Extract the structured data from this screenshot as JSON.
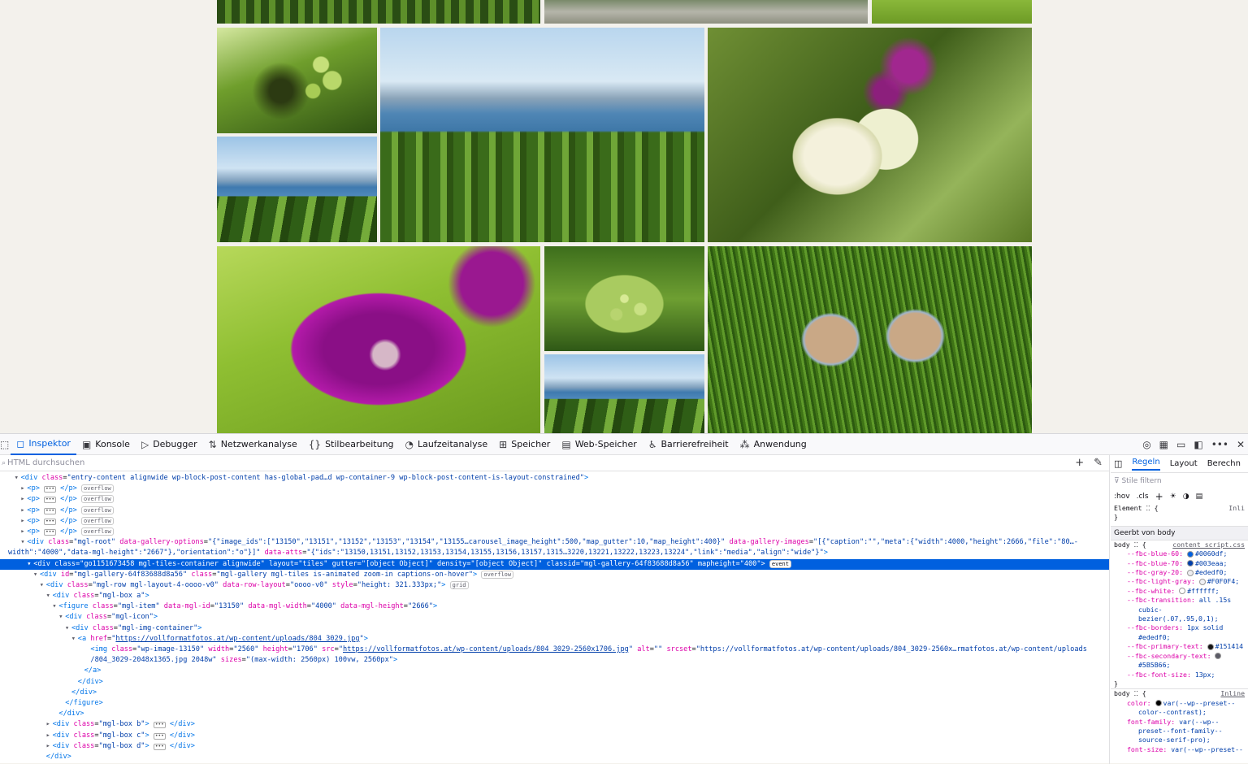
{
  "devtools": {
    "tabs": [
      {
        "label": "Inspektor",
        "icon": "inspector-icon"
      },
      {
        "label": "Konsole",
        "icon": "console-icon"
      },
      {
        "label": "Debugger",
        "icon": "debugger-icon"
      },
      {
        "label": "Netzwerkanalyse",
        "icon": "network-icon"
      },
      {
        "label": "Stilbearbeitung",
        "icon": "style-editor-icon"
      },
      {
        "label": "Laufzeitanalyse",
        "icon": "performance-icon"
      },
      {
        "label": "Speicher",
        "icon": "memory-icon"
      },
      {
        "label": "Web-Speicher",
        "icon": "storage-icon"
      },
      {
        "label": "Barrierefreiheit",
        "icon": "accessibility-icon"
      },
      {
        "label": "Anwendung",
        "icon": "application-icon"
      }
    ],
    "search_placeholder": "HTML durchsuchen",
    "rules_tabs": [
      "Regeln",
      "Layout",
      "Berechn"
    ],
    "filter_placeholder": "Stile filtern",
    "pseudo_buttons": [
      ":hov",
      ".cls"
    ],
    "element_selector": "Element",
    "element_source": "Inli",
    "inherited_header": "Geerbt von body",
    "body_rule1": {
      "selector": "body",
      "source": "content_script.css",
      "props": [
        {
          "name": "--fbc-blue-60:",
          "value": "#0060df;",
          "color": "#0060df"
        },
        {
          "name": "--fbc-blue-70:",
          "value": "#003eaa;",
          "color": "#003eaa"
        },
        {
          "name": "--fbc-gray-20:",
          "value": "#ededf0;",
          "color": "#ededf0"
        },
        {
          "name": "--fbc-light-gray:",
          "value": "#F0F0F4;",
          "color": "#F0F0F4"
        },
        {
          "name": "--fbc-white:",
          "value": "#ffffff;",
          "color": "#ffffff"
        },
        {
          "name": "--fbc-transition:",
          "value": "all .15s",
          "color": ""
        },
        {
          "name": "",
          "value": "cubic-",
          "color": ""
        },
        {
          "name": "",
          "value": "bezier(.07,.95,0,1);",
          "color": ""
        },
        {
          "name": "--fbc-borders:",
          "value": "1px solid",
          "color": ""
        },
        {
          "name": "",
          "value": "#ededf0;",
          "color": ""
        },
        {
          "name": "--fbc-primary-text:",
          "value": "#151414",
          "color": "#151414"
        },
        {
          "name": "--fbc-secondary-text:",
          "value": "",
          "color": "#5B5B66"
        },
        {
          "name": "",
          "value": "#5B5B66;",
          "color": ""
        },
        {
          "name": "--fbc-font-size:",
          "value": "13px;",
          "color": ""
        }
      ]
    },
    "body_rule2": {
      "selector": "body",
      "source": "Inline",
      "props": [
        {
          "name": "color:",
          "value": "var(--wp--preset--",
          "color": "#000000"
        },
        {
          "name": "",
          "value": "color--contrast);",
          "color": ""
        },
        {
          "name": "font-family:",
          "value": "var(--wp--",
          "color": ""
        },
        {
          "name": "",
          "value": "preset--font-family--",
          "color": ""
        },
        {
          "name": "",
          "value": "source-serif-pro);",
          "color": ""
        },
        {
          "name": "font-size:",
          "value": "var(--wp--preset--",
          "color": ""
        }
      ]
    }
  },
  "html_tree": [
    {
      "indent": 4,
      "tw": "open",
      "html": "<span class=\"tag\">&lt;div</span> <span class=\"an\">class</span>=<span class=\"av\">\"entry-content alignwide wp-block-post-content has-global-pad…d wp-container-9 wp-block-post-content-is-layout-constrained\"</span><span class=\"tag\">&gt;</span>"
    },
    {
      "indent": 6,
      "tw": "closed",
      "html": "<span class=\"tag\">&lt;p&gt;</span> <span class=\"dots\">•••</span> <span class=\"tag\">&lt;/p&gt;</span> <span class=\"badge\">overflow</span>"
    },
    {
      "indent": 6,
      "tw": "closed",
      "html": "<span class=\"tag\">&lt;p&gt;</span> <span class=\"dots\">•••</span> <span class=\"tag\">&lt;/p&gt;</span> <span class=\"badge\">overflow</span>"
    },
    {
      "indent": 6,
      "tw": "closed",
      "html": "<span class=\"tag\">&lt;p&gt;</span> <span class=\"dots\">•••</span> <span class=\"tag\">&lt;/p&gt;</span> <span class=\"badge\">overflow</span>"
    },
    {
      "indent": 6,
      "tw": "closed",
      "html": "<span class=\"tag\">&lt;p&gt;</span> <span class=\"dots\">•••</span> <span class=\"tag\">&lt;/p&gt;</span> <span class=\"badge\">overflow</span>"
    },
    {
      "indent": 6,
      "tw": "closed",
      "html": "<span class=\"tag\">&lt;p&gt;</span> <span class=\"dots\">•••</span> <span class=\"tag\">&lt;/p&gt;</span> <span class=\"badge\">overflow</span>"
    },
    {
      "indent": 6,
      "tw": "open",
      "html": "<span class=\"tag\">&lt;div</span> <span class=\"an\">class</span>=<span class=\"av\">\"mgl-root\"</span> <span class=\"an\">data-gallery-options</span>=<span class=\"av\">\"{\"image_ids\":[\"13150\",\"13151\",\"13152\",\"13153\",\"13154\",\"13155…carousel_image_height\":500,\"map_gutter\":10,\"map_height\":400}\"</span> <span class=\"an\">data-gallery-images</span>=<span class=\"av\">\"[{\"caption\":\"\",\"meta\":{\"width\":4000,\"height\":2666,\"file\":\"80…-</span>"
    },
    {
      "indent": 0,
      "tw": "none",
      "html": "<span class=\"av\">width\":\"4000\",\"data-mgl-height\":\"2667\"},\"orientation\":\"o\"}]\"</span> <span class=\"an\">data-atts</span>=<span class=\"av\">\"{\"ids\":\"13150,13151,13152,13153,13154,13155,13156,13157,1315…3220,13221,13222,13223,13224\",\"link\":\"media\",\"align\":\"wide\"}\"</span><span class=\"tag\">&gt;</span>"
    },
    {
      "indent": 8,
      "tw": "open",
      "sel": true,
      "html": "<span class=\"tag\">&lt;div</span> <span class=\"an\">class</span>=<span class=\"av\">\"go1151673458 mgl-tiles-container alignwide\"</span> <span class=\"an\">layout</span>=<span class=\"av\">\"tiles\"</span> <span class=\"an\">gutter</span>=<span class=\"av\">\"[object Object]\"</span> <span class=\"an\">density</span>=<span class=\"av\">\"[object Object]\"</span> <span class=\"an\">classid</span>=<span class=\"av\">\"mgl-gallery-64f83688d8a56\"</span> <span class=\"an\">mapheight</span>=<span class=\"av\">\"400\"</span><span class=\"tag\">&gt;</span> <span class=\"badge\">event</span>"
    },
    {
      "indent": 10,
      "tw": "open",
      "html": "<span class=\"tag\">&lt;div</span> <span class=\"an\">id</span>=<span class=\"av\">\"mgl-gallery-64f83688d8a56\"</span> <span class=\"an\">class</span>=<span class=\"av\">\"mgl-gallery mgl-tiles is-animated zoom-in captions-on-hover\"</span><span class=\"tag\">&gt;</span> <span class=\"badge\">overflow</span>"
    },
    {
      "indent": 12,
      "tw": "open",
      "html": "<span class=\"tag\">&lt;div</span> <span class=\"an\">class</span>=<span class=\"av\">\"mgl-row mgl-layout-4-oooo-v0\"</span> <span class=\"an\">data-row-layout</span>=<span class=\"av\">\"oooo-v0\"</span> <span class=\"an\">style</span>=<span class=\"av\">\"height: 321.333px;\"</span><span class=\"tag\">&gt;</span> <span class=\"badge\">grid</span>"
    },
    {
      "indent": 14,
      "tw": "open",
      "html": "<span class=\"tag\">&lt;div</span> <span class=\"an\">class</span>=<span class=\"av\">\"mgl-box a\"</span><span class=\"tag\">&gt;</span>"
    },
    {
      "indent": 16,
      "tw": "open",
      "html": "<span class=\"tag\">&lt;figure</span> <span class=\"an\">class</span>=<span class=\"av\">\"mgl-item\"</span> <span class=\"an\">data-mgl-id</span>=<span class=\"av\">\"13150\"</span> <span class=\"an\">data-mgl-width</span>=<span class=\"av\">\"4000\"</span> <span class=\"an\">data-mgl-height</span>=<span class=\"av\">\"2666\"</span><span class=\"tag\">&gt;</span>"
    },
    {
      "indent": 18,
      "tw": "open",
      "html": "<span class=\"tag\">&lt;div</span> <span class=\"an\">class</span>=<span class=\"av\">\"mgl-icon\"</span><span class=\"tag\">&gt;</span>"
    },
    {
      "indent": 20,
      "tw": "open",
      "html": "<span class=\"tag\">&lt;div</span> <span class=\"an\">class</span>=<span class=\"av\">\"mgl-img-container\"</span><span class=\"tag\">&gt;</span>"
    },
    {
      "indent": 22,
      "tw": "open",
      "html": "<span class=\"tag\">&lt;a</span> <span class=\"an\">href</span>=<span class=\"av\">\"<span class=\"link\">https://vollformatfotos.at/wp-content/uploads/804_3029.jpg</span>\"</span><span class=\"tag\">&gt;</span>"
    },
    {
      "indent": 26,
      "tw": "none",
      "html": "<span class=\"tag\">&lt;img</span> <span class=\"an\">class</span>=<span class=\"av\">\"wp-image-13150\"</span> <span class=\"an\">width</span>=<span class=\"av\">\"2560\"</span> <span class=\"an\">height</span>=<span class=\"av\">\"1706\"</span> <span class=\"an\">src</span>=<span class=\"av\">\"<span class=\"link\">https://vollformatfotos.at/wp-content/uploads/804_3029-2560x1706.jpg</span>\"</span> <span class=\"an\">alt</span>=<span class=\"av\">\"\"</span> <span class=\"an\">srcset</span>=<span class=\"av\">\"https://vollformatfotos.at/wp-content/uploads/804_3029-2560x…rmatfotos.at/wp-content/uploads</span>"
    },
    {
      "indent": 26,
      "tw": "none",
      "html": "<span class=\"av\">/804_3029-2048x1365.jpg 2048w\"</span> <span class=\"an\">sizes</span>=<span class=\"av\">\"(max-width: 2560px) 100vw, 2560px\"</span><span class=\"tag\">&gt;</span>"
    },
    {
      "indent": 24,
      "tw": "none",
      "html": "<span class=\"tag\">&lt;/a&gt;</span>"
    },
    {
      "indent": 22,
      "tw": "none",
      "html": "<span class=\"tag\">&lt;/div&gt;</span>"
    },
    {
      "indent": 20,
      "tw": "none",
      "html": "<span class=\"tag\">&lt;/div&gt;</span>"
    },
    {
      "indent": 18,
      "tw": "none",
      "html": "<span class=\"tag\">&lt;/figure&gt;</span>"
    },
    {
      "indent": 16,
      "tw": "none",
      "html": "<span class=\"tag\">&lt;/div&gt;</span>"
    },
    {
      "indent": 14,
      "tw": "closed",
      "html": "<span class=\"tag\">&lt;div</span> <span class=\"an\">class</span>=<span class=\"av\">\"mgl-box b\"</span><span class=\"tag\">&gt;</span> <span class=\"dots\">•••</span> <span class=\"tag\">&lt;/div&gt;</span>"
    },
    {
      "indent": 14,
      "tw": "closed",
      "html": "<span class=\"tag\">&lt;div</span> <span class=\"an\">class</span>=<span class=\"av\">\"mgl-box c\"</span><span class=\"tag\">&gt;</span> <span class=\"dots\">•••</span> <span class=\"tag\">&lt;/div&gt;</span>"
    },
    {
      "indent": 14,
      "tw": "closed",
      "html": "<span class=\"tag\">&lt;div</span> <span class=\"an\">class</span>=<span class=\"av\">\"mgl-box d\"</span><span class=\"tag\">&gt;</span> <span class=\"dots\">•••</span> <span class=\"tag\">&lt;/div&gt;</span>"
    },
    {
      "indent": 12,
      "tw": "none",
      "html": "<span class=\"tag\">&lt;/div&gt;</span>"
    }
  ]
}
